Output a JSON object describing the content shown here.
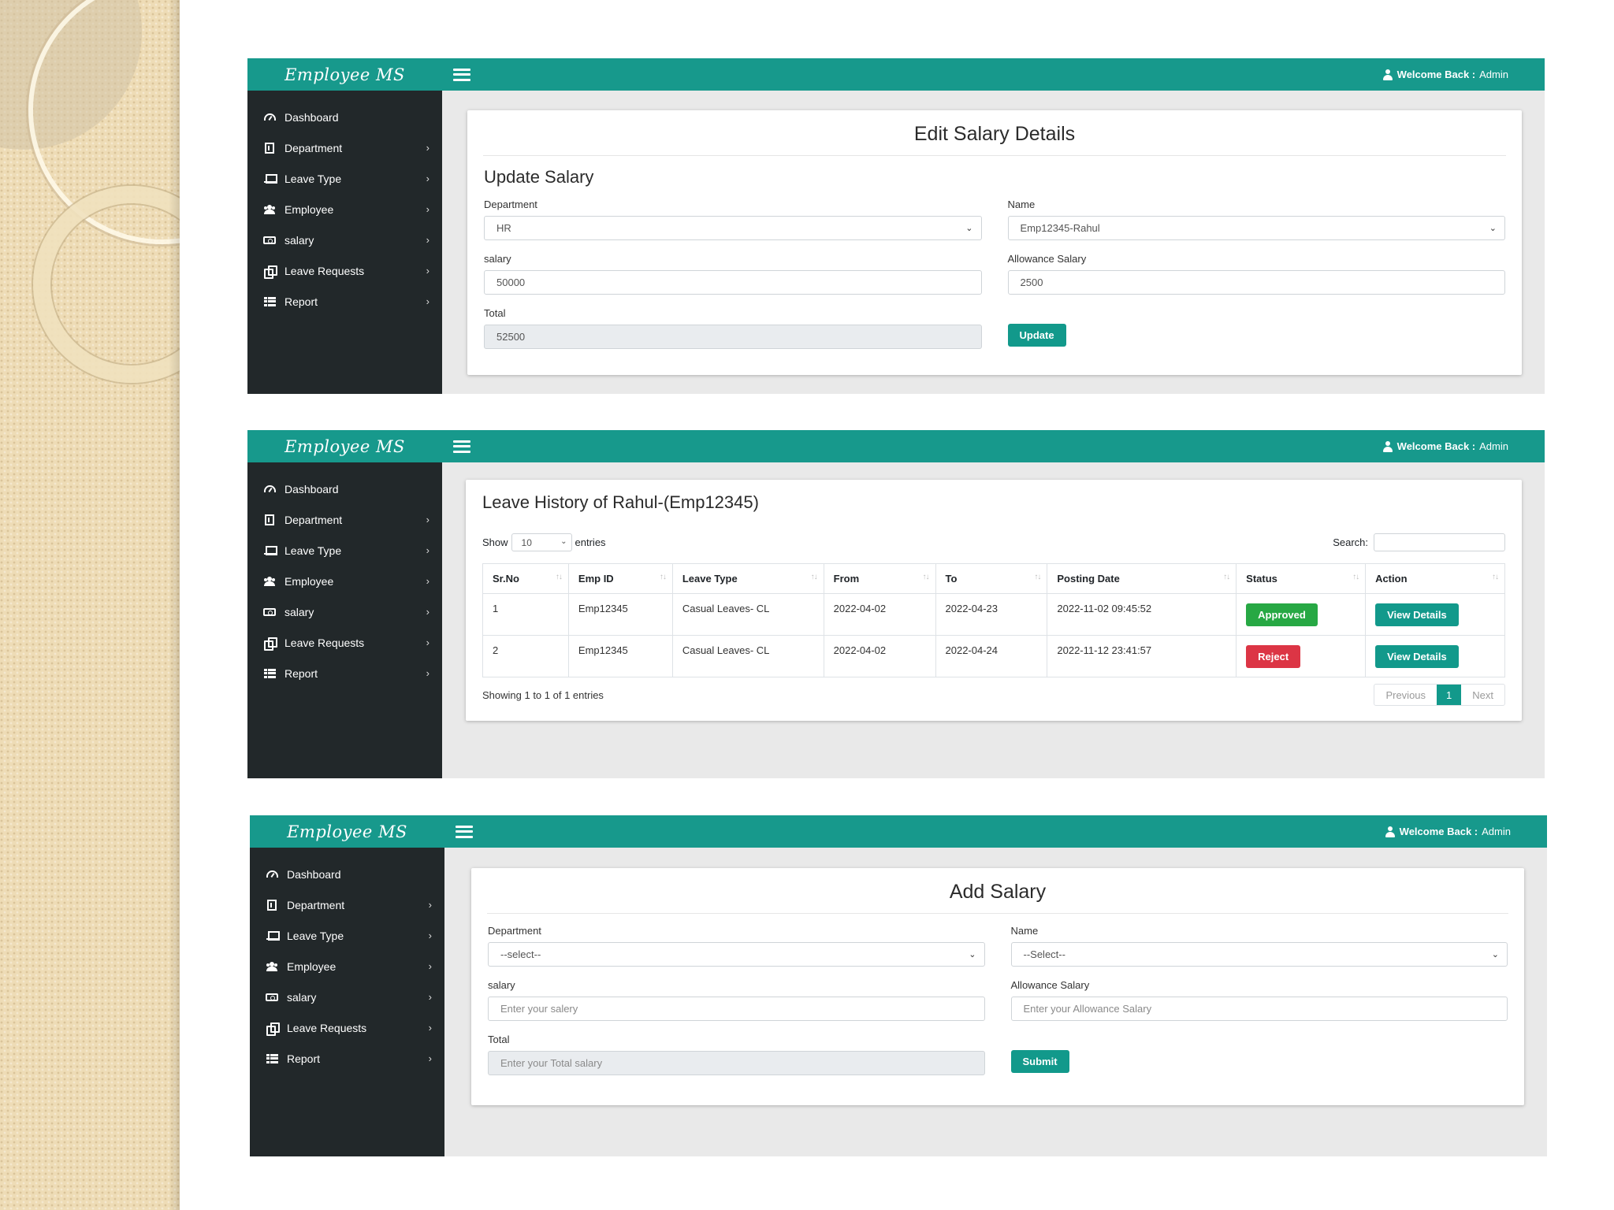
{
  "brand": "Employee MS",
  "welcome": {
    "label": "Welcome Back :",
    "user": "Admin"
  },
  "nav": [
    {
      "label": "Dashboard",
      "icon": "dashboard-icon",
      "chevron": false
    },
    {
      "label": "Department",
      "icon": "building-icon",
      "chevron": true
    },
    {
      "label": "Leave Type",
      "icon": "laptop-icon",
      "chevron": true
    },
    {
      "label": "Employee",
      "icon": "users-icon",
      "chevron": true
    },
    {
      "label": "salary",
      "icon": "money-icon",
      "chevron": true
    },
    {
      "label": "Leave Requests",
      "icon": "copy-icon",
      "chevron": true
    },
    {
      "label": "Report",
      "icon": "table-icon",
      "chevron": true
    }
  ],
  "edit_salary": {
    "title": "Edit Salary Details",
    "subtitle": "Update Salary",
    "department": {
      "label": "Department",
      "value": "HR"
    },
    "name": {
      "label": "Name",
      "value": "Emp12345-Rahul"
    },
    "salary": {
      "label": "salary",
      "value": "50000"
    },
    "allowance": {
      "label": "Allowance Salary",
      "value": "2500"
    },
    "total": {
      "label": "Total",
      "value": "52500"
    },
    "button": "Update"
  },
  "leave_history": {
    "title": "Leave History of Rahul-(Emp12345)",
    "show_label": "Show",
    "entries_value": "10",
    "entries_label": "entries",
    "search_label": "Search:",
    "columns": [
      "Sr.No",
      "Emp ID",
      "Leave Type",
      "From",
      "To",
      "Posting Date",
      "Status",
      "Action"
    ],
    "rows": [
      {
        "srno": "1",
        "emp_id": "Emp12345",
        "leave_type": "Casual Leaves- CL",
        "from": "2022-04-02",
        "to": "2022-04-23",
        "posting_date": "2022-11-02 09:45:52",
        "status": "Approved",
        "action": "View Details"
      },
      {
        "srno": "2",
        "emp_id": "Emp12345",
        "leave_type": "Casual Leaves- CL",
        "from": "2022-04-02",
        "to": "2022-04-24",
        "posting_date": "2022-11-12 23:41:57",
        "status": "Reject",
        "action": "View Details"
      }
    ],
    "info": "Showing 1 to 1 of 1 entries",
    "pager": {
      "previous": "Previous",
      "current": "1",
      "next": "Next"
    }
  },
  "add_salary": {
    "title": "Add Salary",
    "department": {
      "label": "Department",
      "value": "--select--"
    },
    "name": {
      "label": "Name",
      "value": "--Select--"
    },
    "salary": {
      "label": "salary",
      "placeholder": "Enter your salery"
    },
    "allowance": {
      "label": "Allowance Salary",
      "placeholder": "Enter your Allowance Salary"
    },
    "total": {
      "label": "Total",
      "placeholder": "Enter your Total salary"
    },
    "button": "Submit"
  },
  "colors": {
    "teal": "#17998c",
    "sidebar": "#22282a",
    "approved": "#27a844",
    "reject": "#dc3545"
  }
}
